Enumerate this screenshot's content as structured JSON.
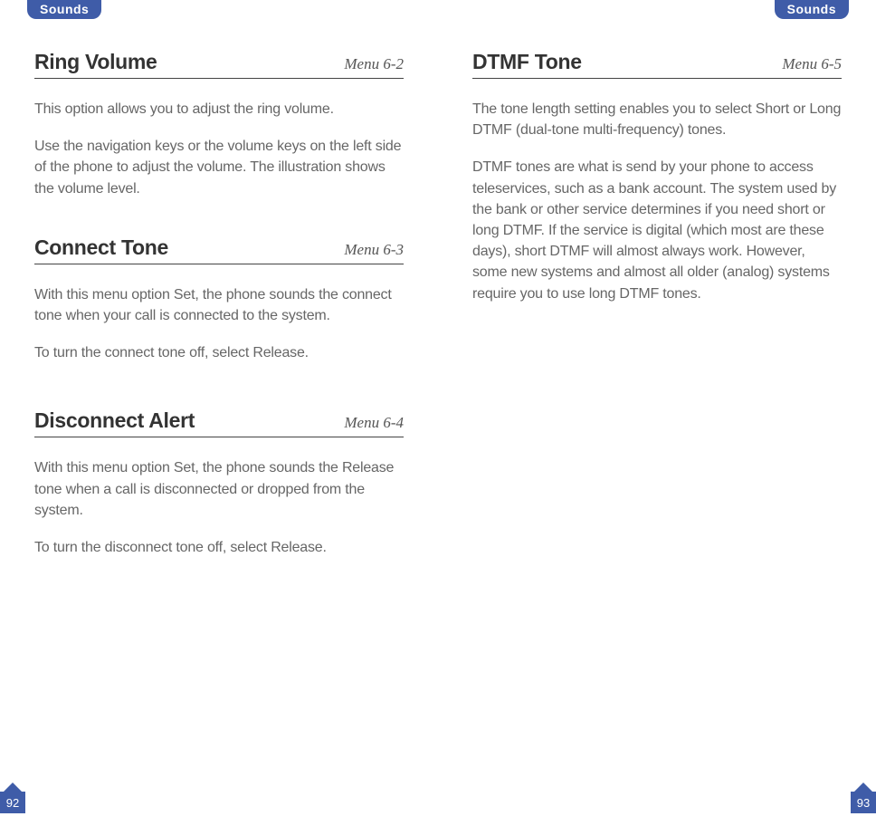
{
  "leftPage": {
    "tab": "Sounds",
    "pageNumber": "92",
    "sections": [
      {
        "title": "Ring Volume",
        "menu": "Menu 6-2",
        "paras": [
          "This option allows you to adjust the ring volume.",
          "Use the navigation keys or the volume keys on the left side of the phone to adjust the volume. The illustration shows the volume level."
        ]
      },
      {
        "title": "Connect Tone",
        "menu": "Menu 6-3",
        "paras": [
          "With this menu option Set, the phone sounds the connect tone when your call is connected to the system.",
          "To turn the connect tone off, select Release."
        ]
      },
      {
        "title": "Disconnect Alert",
        "menu": "Menu 6-4",
        "paras": [
          "With this menu option Set, the phone sounds the Release tone when a call is disconnected or dropped from the system.",
          "To turn the disconnect tone off, select Release."
        ]
      }
    ]
  },
  "rightPage": {
    "tab": "Sounds",
    "pageNumber": "93",
    "sections": [
      {
        "title": "DTMF Tone",
        "menu": "Menu 6-5",
        "paras": [
          "The tone length setting enables you to select Short or Long DTMF (dual-tone multi-frequency) tones.",
          "DTMF tones are what is send by your phone to access teleservices, such as a bank account. The system used by the bank or other service determines if you need short or long DTMF. If the service is digital (which most are these days), short DTMF will almost always work. However, some new systems and almost all older (analog) systems require you to use long DTMF tones."
        ]
      }
    ]
  }
}
